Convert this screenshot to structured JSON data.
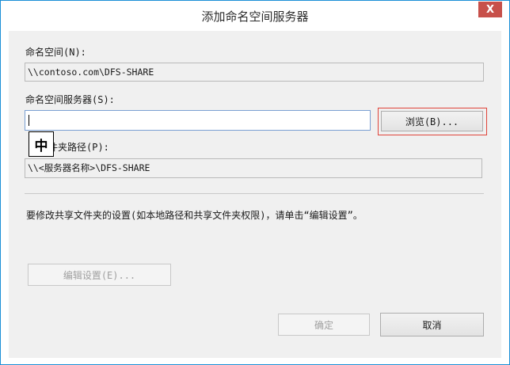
{
  "window": {
    "title": "添加命名空间服务器",
    "close_glyph": "X"
  },
  "namespace": {
    "label": "命名空间(N):",
    "value": "\\\\contoso.com\\DFS-SHARE"
  },
  "server": {
    "label": "命名空间服务器(S):",
    "value": "",
    "browse_label": "浏览(B)..."
  },
  "ime": {
    "indicator": "中"
  },
  "shared_folder": {
    "label_visible": "件夹路径(P):",
    "value": "\\\\<服务器名称>\\DFS-SHARE"
  },
  "info": {
    "text": "要修改共享文件夹的设置(如本地路径和共享文件夹权限)，请单击“编辑设置”。"
  },
  "buttons": {
    "edit_settings": "编辑设置(E)...",
    "ok": "确定",
    "cancel": "取消"
  },
  "colors": {
    "window_border": "#1b8fd6",
    "close_button": "#c7504a",
    "client_bg": "#f0f0f0",
    "focus_ring": "#e0443a"
  }
}
